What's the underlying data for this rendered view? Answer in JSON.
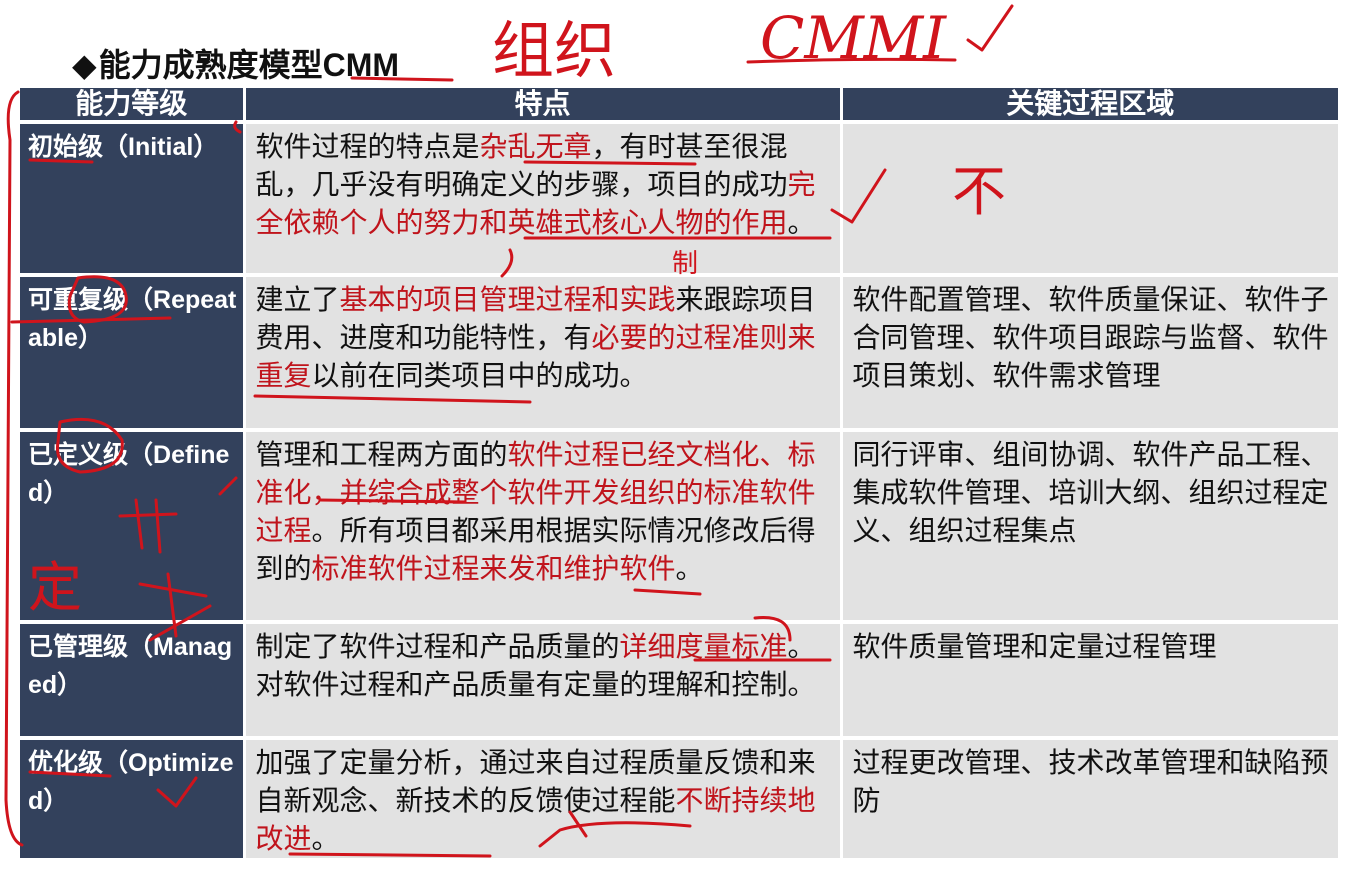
{
  "title": {
    "bullet": "◆",
    "text": "能力成熟度模型",
    "suffix": "CMM"
  },
  "handwriting": {
    "word_cn": "组织",
    "word_en": "CMMI",
    "mark_bu": "不",
    "mark_ding": "定",
    "mark_zhi": "制"
  },
  "table": {
    "headers": [
      "能力等级",
      "特点",
      "关键过程区域"
    ],
    "rows": [
      {
        "level_cn": "初始级",
        "level_en": "（Initial）",
        "features": [
          {
            "t": "软件过程的特点是"
          },
          {
            "t": "杂乱无章",
            "hl": true
          },
          {
            "t": "，有时甚至很混乱，几乎没有明确定义的步骤，项目的成功"
          },
          {
            "t": "完全依赖个人的努力和英雄式核心人物的作用",
            "hl": true
          },
          {
            "t": "。"
          }
        ],
        "area": ""
      },
      {
        "level_cn": "可重复级",
        "level_en": "（Repeatable）",
        "features": [
          {
            "t": "建立了"
          },
          {
            "t": "基本的项目管理过程和实践",
            "hl": true
          },
          {
            "t": "来跟踪项目费用、进度和功能特性，有"
          },
          {
            "t": "必要的过程准则来重复",
            "hl": true
          },
          {
            "t": "以前在同类项目中的成功。"
          }
        ],
        "area": "软件配置管理、软件质量保证、软件子合同管理、软件项目跟踪与监督、软件项目策划、软件需求管理"
      },
      {
        "level_cn": "已定义级",
        "level_en": "（Defined）",
        "features": [
          {
            "t": "管理和工程两方面的"
          },
          {
            "t": "软件过程已经文档化、标准化，并综合成整个软件开发组织的标准软件过程",
            "hl": true
          },
          {
            "t": "。所有项目都采用根据实际情况修改后得到的"
          },
          {
            "t": "标准软件过程来发和维护软件",
            "hl": true
          },
          {
            "t": "。"
          }
        ],
        "area": "同行评审、组间协调、软件产品工程、集成软件管理、培训大纲、组织过程定义、组织过程集点"
      },
      {
        "level_cn": "已管理级",
        "level_en": "（Managed）",
        "features": [
          {
            "t": "制定了软件过程和产品质量的"
          },
          {
            "t": "详细度量标准",
            "hl": true
          },
          {
            "t": "。对软件过程和产品质量有定量的理解和控制。"
          }
        ],
        "area": "软件质量管理和定量过程管理"
      },
      {
        "level_cn": "优化级",
        "level_en": "（Optimized）",
        "features": [
          {
            "t": "加强了定量分析，通过来自过程质量反馈和来自新观念、新技术的反馈使过程能"
          },
          {
            "t": "不断持续地改进",
            "hl": true
          },
          {
            "t": "。"
          }
        ],
        "area": "过程更改管理、技术改革管理和缺陷预防"
      }
    ]
  },
  "colors": {
    "header_bg": "#33415c",
    "cell_bg": "#e2e2e2",
    "highlight": "#c0141c",
    "ink": "#d0141c"
  }
}
